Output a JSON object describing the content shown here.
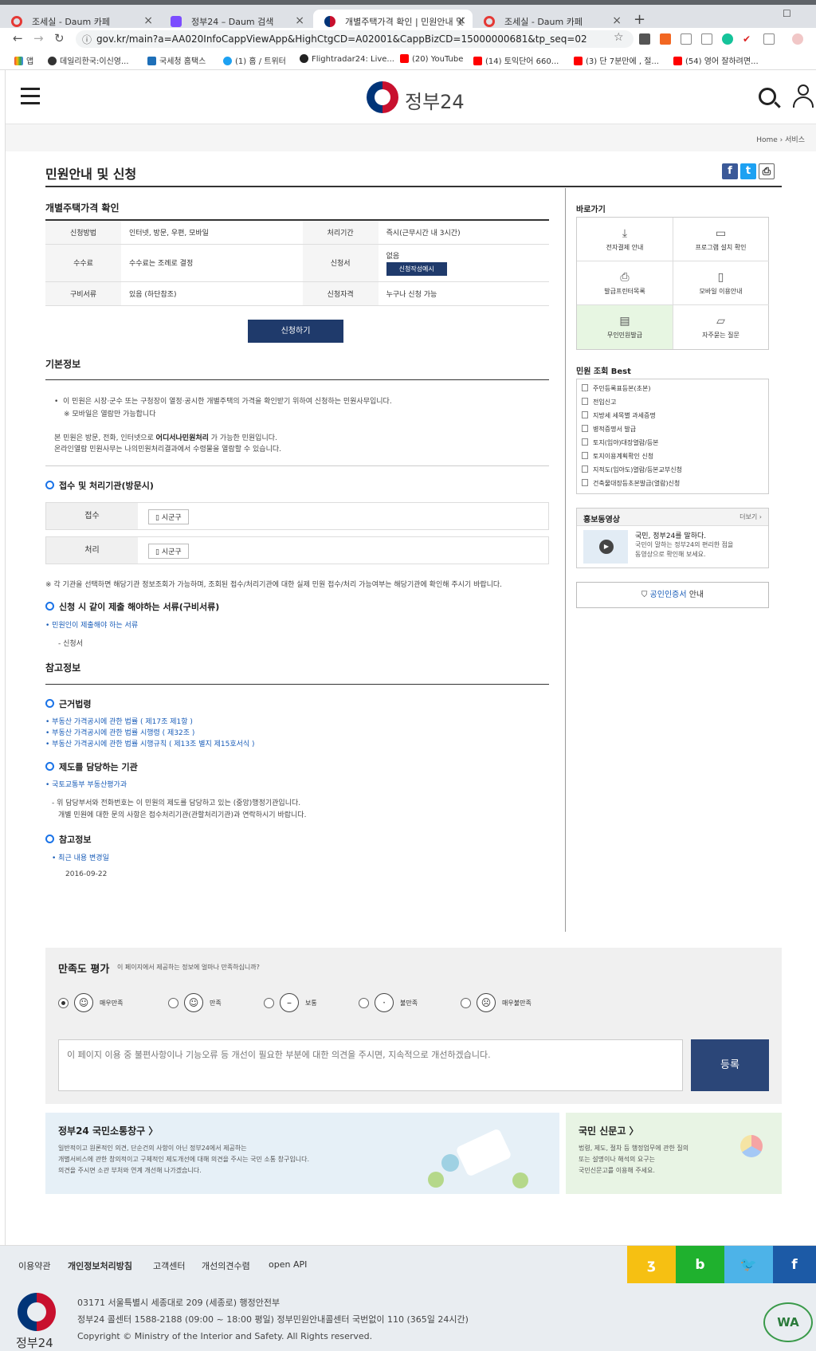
{
  "browser": {
    "tabs": [
      {
        "title": "조세실 - Daum 카페",
        "color": "#e53935"
      },
      {
        "title": "정부24 – Daum 검색",
        "color": "#7c4dff"
      },
      {
        "title": "개별주택가격 확인 | 민원안내 및",
        "color": "#003478"
      },
      {
        "title": "조세실 - Daum 카페",
        "color": "#e53935"
      }
    ],
    "url": "gov.kr/main?a=AA020InfoCappViewApp&HighCtgCD=A02001&CappBizCD=15000000681&tp_seq=02",
    "bookmarks": [
      "앱",
      "데일리한국:이신영...",
      "국세청 홈택스",
      "(1) 홈 / 트위터",
      "Flightradar24: Live...",
      "(20) YouTube",
      "(14) 토익단어 660...",
      "(3) 단 7분만에 , 절...",
      "(54) 영어 잘하려면..."
    ]
  },
  "header": {
    "logo_text": "정부24",
    "breadcrumb": [
      "Home",
      "서비스"
    ]
  },
  "page": {
    "title": "민원안내 및 신청",
    "service_name": "개별주택가격 확인",
    "info": {
      "method_label": "신청방법",
      "method_value": "인터넷, 방문, 우편, 모바일",
      "period_label": "처리기간",
      "period_value": "즉시(근무시간 내 3시간)",
      "fee_label": "수수료",
      "fee_value": "수수료는 조례로 결정",
      "form_label": "신청서",
      "form_value": "없음",
      "form_button": "신청작성예시",
      "docs_label": "구비서류",
      "docs_value": "있음 (하단참조)",
      "qual_label": "신청자격",
      "qual_value": "누구나 신청 가능"
    },
    "apply_button": "신청하기",
    "basic_info_title": "기본정보",
    "basic_info": {
      "line1": "이 민원은 시장·군수 또는 구청장이 열정·공시한 개별주택의 가격을 확인받기 위하여 신청하는 민원사무입니다.",
      "line2": "※ 모바일은 열람만 가능합니다",
      "line3_pre": "본 민원은 방문, 전화, 인터넷으로 ",
      "line3_bold": "어디서나민원처리",
      "line3_post": " 가 가능한 민원입니다.",
      "line4": "온라인열람 민원사무는 나의민원처리결과에서 수령물을 열람할 수 있습니다."
    },
    "office_title": "접수 및 처리기관(방문시)",
    "office_rows": [
      {
        "label": "접수",
        "tag": "시군구"
      },
      {
        "label": "처리",
        "tag": "시군구"
      }
    ],
    "office_note": "※ 각 기관을 선택하면 해당기관 정보조회가 가능하며, 조회된 접수/처리기관에 대한 실제 민원 접수/처리 가능여부는 해당기관에 확인해 주시기 바랍니다.",
    "docs_title": "신청 시 같이 제출 해야하는 서류(구비서류)",
    "docs_sub": "민원인이 제출해야 하는 서류",
    "docs_item": "신청서",
    "ref_title": "참고정보",
    "law_title": "근거법령",
    "laws": [
      "부동산 가격공시에 관한 법률 ( 제17조 제1항 )",
      "부동산 가격공시에 관한 법률 시행령 ( 제32조 )",
      "부동산 가격공시에 관한 법률 시행규칙 ( 제13조 별지 제15호서식 )"
    ],
    "dept_title": "제도를 담당하는 기관",
    "dept_link": "국토교통부  부동산평가과",
    "dept_note1": "- 위 담당부서와 전화번호는 이 민원의 제도를 담당하고 있는 (중앙)행정기관입니다.",
    "dept_note2": "개별 민원에 대한 문의 사항은 접수처리기관(관할처리기관)과 연락하시기 바랍니다.",
    "ref2_title": "참고정보",
    "ref2_link": "최근 내용 변경일",
    "ref2_date": "2016-09-22"
  },
  "sidebar": {
    "quick_title": "바로가기",
    "quick": [
      {
        "label": "전자결제 안내",
        "icon": "⤓"
      },
      {
        "label": "프로그램 설치 확인",
        "icon": "▭"
      },
      {
        "label": "발급프린터목록",
        "icon": "⎙"
      },
      {
        "label": "모바일 이용안내",
        "icon": "▯"
      },
      {
        "label": "무인민원발급",
        "icon": "▤"
      },
      {
        "label": "자주묻는 질문",
        "icon": "▱"
      }
    ],
    "best_title": "민원 조회 Best",
    "best": [
      "주민등록표등본(초본)",
      "전입신고",
      "지방세 세목별 과세증명",
      "병적증명서 발급",
      "토지(임야)대장열람/등본",
      "토지이용계획확인 신청",
      "지적도(임야도)열람/등본교부신청",
      "건축물대장등초본발급(열람)신청"
    ],
    "promo_title": "홍보동영상",
    "promo_more": "더보기",
    "promo_line1": "국민, 정부24를 말하다.",
    "promo_line2": "국민이 말하는 정부24의 편리한 점을",
    "promo_line3": "동영상으로 확인해 보세요.",
    "cert_link": "공인인증서",
    "cert_suffix": " 안내"
  },
  "satisfaction": {
    "title": "만족도 평가",
    "subtitle": "이 페이지에서 제공하는 정보에 얼마나 만족하십니까?",
    "options": [
      "매우만족",
      "만족",
      "보통",
      "불만족",
      "매우불만족"
    ],
    "placeholder": "이 페이지 이용 중 불편사항이나 기능오류 등 개선이 필요한 부분에 대한 의견을 주시면, 지속적으로 개선하겠습니다.",
    "submit": "등록"
  },
  "banners": {
    "left_title": "정부24 국민소통창구 〉",
    "left_l1": "일반적이고 원론적인 의견, 단순건의 사항이 아닌 정부24에서 제공하는",
    "left_l2": "개별서비스에 관한 창의적이고 구체적인 제도개선에 대해 의견을 주시는 국민 소통 창구입니다.",
    "left_l3": "의견을 주시면 소관 부처와 연계 개선해 나가겠습니다.",
    "right_title": "국민 신문고 〉",
    "right_l1": "법령, 제도, 절차 등 행정업무에 관한 질의",
    "right_l2": "또는 설명이나 해석의 요구는",
    "right_l3": "국민신문고를 이용해 주세요."
  },
  "footer": {
    "links": [
      "이용약관",
      "개인정보처리방침",
      "고객센터",
      "개선의견수렴",
      "open API"
    ],
    "sns": [
      {
        "label": "ʒ",
        "color": "#f6c012"
      },
      {
        "label": "b",
        "color": "#1fb12e"
      },
      {
        "label": "🐦",
        "color": "#4db3e8"
      },
      {
        "label": "f",
        "color": "#1c5aa6"
      }
    ],
    "addr1": "03171 서울특별시 세종대로 209 (세종로) 행정안전부",
    "addr2": "정부24 콜센터 1588-2188 (09:00 ~ 18:00 평일) 정부민원안내콜센터 국번없이 110 (365일 24시간)",
    "addr3": "Copyright © Ministry of the Interior and Safety. All Rights reserved.",
    "logo_text": "정부24",
    "wa_mark": "WA"
  }
}
